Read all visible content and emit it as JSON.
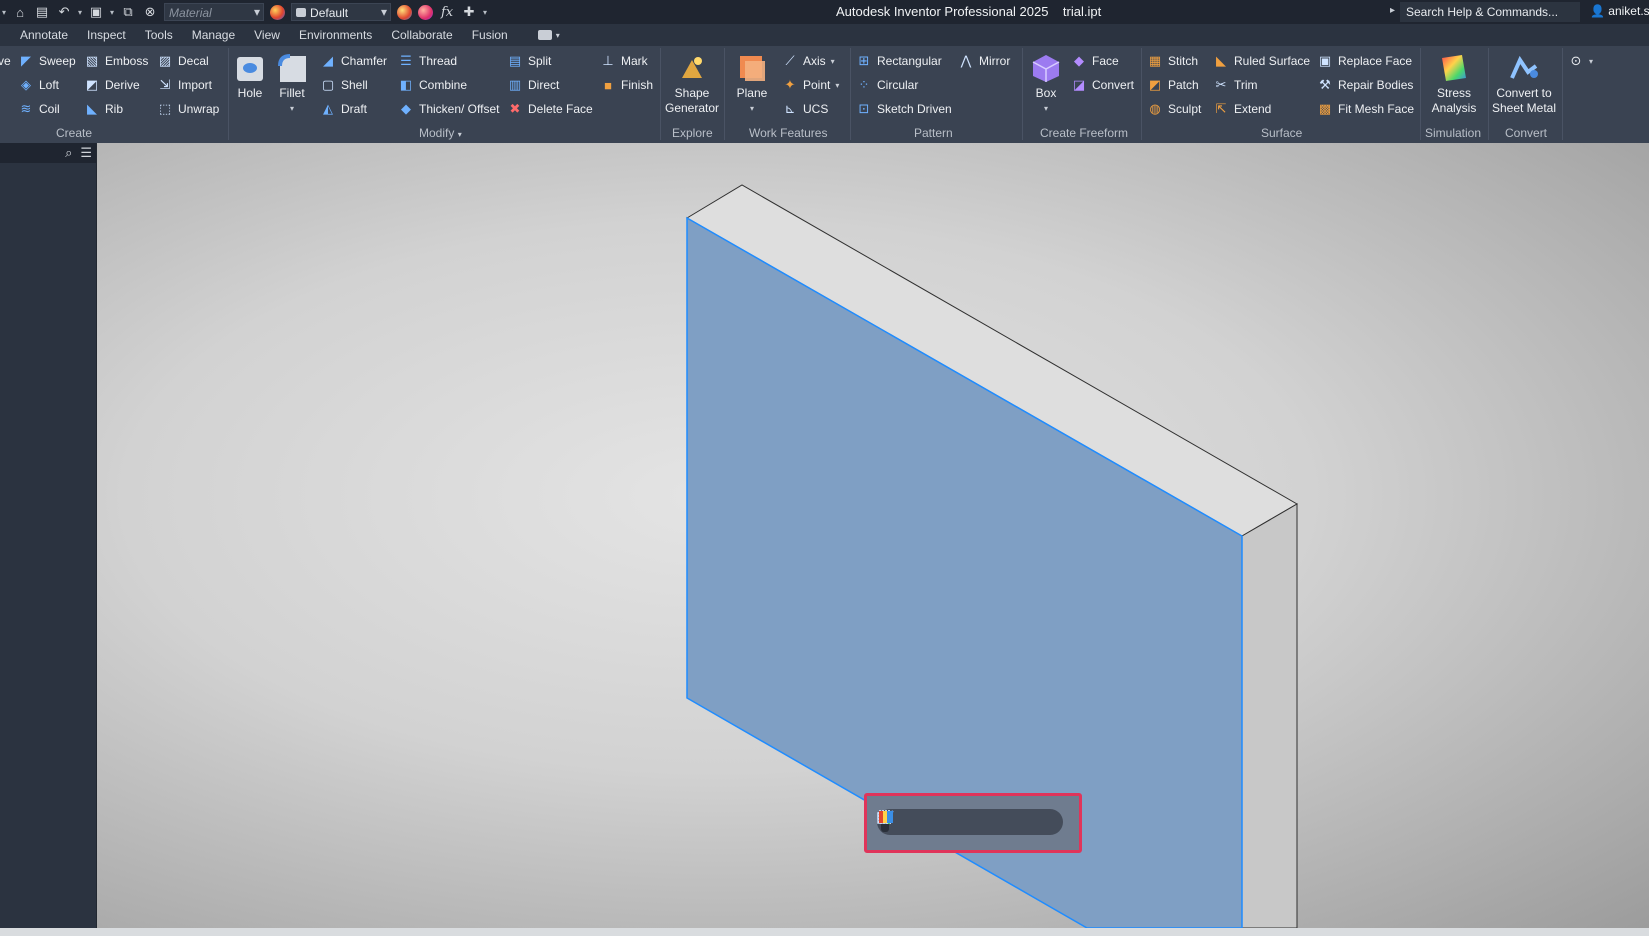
{
  "titlebar": {
    "material_placeholder": "Material",
    "appearance_value": "Default",
    "fx_label": "fx",
    "app_title": "Autodesk Inventor Professional 2025    trial.ipt",
    "search_placeholder": "Search Help & Commands...",
    "user": "aniket.sh"
  },
  "menu": {
    "tabs": [
      "Annotate",
      "Inspect",
      "Tools",
      "Manage",
      "View",
      "Environments",
      "Collaborate",
      "Fusion"
    ]
  },
  "ribbon": {
    "create": {
      "label": "Create",
      "col0": [
        "ve"
      ],
      "col1": [
        "Sweep",
        "Loft",
        "Coil"
      ],
      "col2": [
        "Emboss",
        "Derive",
        "Rib"
      ],
      "col3": [
        "Decal",
        "Import",
        "Unwrap"
      ],
      "hole": "Hole",
      "fillet": "Fillet"
    },
    "modify": {
      "label": "Modify",
      "col1": [
        "Chamfer",
        "Shell",
        "Draft"
      ],
      "col2": [
        "Thread",
        "Combine",
        "Thicken/ Offset"
      ],
      "col3": [
        "Split",
        "Direct",
        "Delete Face"
      ],
      "col4": [
        "Mark",
        "Finish"
      ]
    },
    "explore": {
      "label": "Explore",
      "shape_generator": "Shape\nGenerator"
    },
    "work_features": {
      "label": "Work Features",
      "plane": "Plane",
      "items": [
        "Axis",
        "Point",
        "UCS"
      ]
    },
    "pattern": {
      "label": "Pattern",
      "items": [
        "Rectangular",
        "Circular",
        "Sketch Driven"
      ],
      "mirror": "Mirror"
    },
    "freeform": {
      "label": "Create Freeform",
      "box": "Box",
      "items": [
        "Face",
        "Convert"
      ]
    },
    "surface": {
      "label": "Surface",
      "col1": [
        "Stitch",
        "Patch",
        "Sculpt"
      ],
      "col2": [
        "Ruled Surface",
        "Trim",
        "Extend"
      ],
      "col3": [
        "Replace Face",
        "Repair Bodies",
        "Fit Mesh Face"
      ]
    },
    "simulation": {
      "label": "Simulation",
      "stress": "Stress\nAnalysis"
    },
    "convert": {
      "label": "Convert",
      "sheet_metal": "Convert to\nSheet Metal"
    }
  },
  "colors": {
    "selection_face": "#7f9fc4",
    "selection_edge": "#1f8cff",
    "highlight_frame": "#e0345a"
  },
  "minitoolbar": {
    "icons": [
      "create-sketch-icon",
      "edit-sketch-icon",
      "dimension-icon",
      "constraint-icon",
      "add-sketch-icon",
      "appearance-icon"
    ]
  }
}
